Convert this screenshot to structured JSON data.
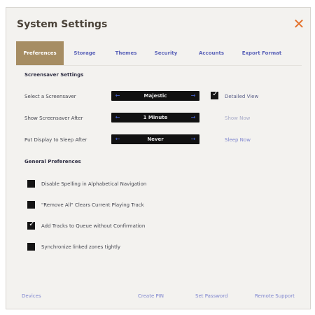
{
  "window": {
    "title": "System Settings",
    "close_icon": "close-icon",
    "accent": "#e3702a"
  },
  "tabs": [
    {
      "label": "Preferences",
      "active": true
    },
    {
      "label": "Storage",
      "active": false
    },
    {
      "label": "Themes",
      "active": false
    },
    {
      "label": "Security",
      "active": false
    },
    {
      "label": "Accounts",
      "active": false
    },
    {
      "label": "Export Format",
      "active": false
    }
  ],
  "screensaver": {
    "section_title": "Screensaver Settings",
    "select_label": "Select a Screensaver",
    "select_value": "Majestic",
    "detailed_view_label": "Detailed View",
    "detailed_view_checked": true,
    "show_after_label": "Show Screensaver After",
    "show_after_value": "1 Minute",
    "show_now_label": "Show Now",
    "sleep_label": "Put Display to Sleep After",
    "sleep_value": "Never",
    "sleep_now_label": "Sleep Now"
  },
  "general": {
    "section_title": "General Preferences",
    "options": [
      {
        "label": "Disable Spelling in Alphabetical Navigation",
        "checked": false
      },
      {
        "label": "\"Remove All\" Clears Current Playing Track",
        "checked": false
      },
      {
        "label": "Add Tracks to Queue without Confirmation",
        "checked": true
      },
      {
        "label": "Synchronize linked zones tightly",
        "checked": false
      }
    ]
  },
  "footer": {
    "devices": "Devices",
    "create_pin": "Create PIN",
    "set_password": "Set Password",
    "remote_support": "Remote Support"
  },
  "colors": {
    "tab_active_bg": "#a68d63",
    "link": "#7f86cf",
    "select_bg": "#111111"
  }
}
